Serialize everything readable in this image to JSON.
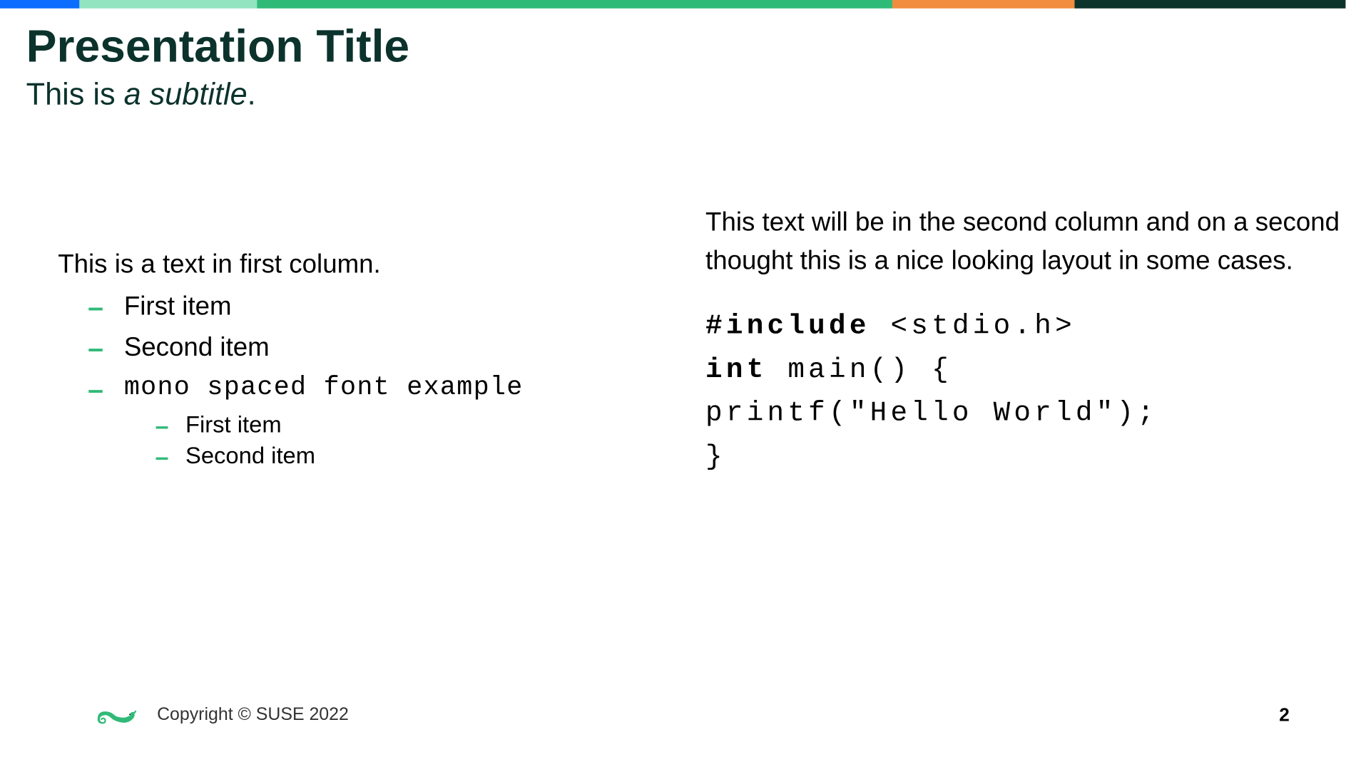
{
  "colors": {
    "bar_blue": "#0d6efd",
    "bar_mint": "#92e3bf",
    "bar_green": "#30ba78",
    "bar_orange": "#f28c3f",
    "bar_dark": "#0c322c",
    "accent_green": "#30ba78",
    "title_color": "#0c322c"
  },
  "title": "Presentation Title",
  "subtitle_prefix": "This is ",
  "subtitle_italic": "a subtitle",
  "subtitle_suffix": ".",
  "left_column": {
    "intro": "This is a text in first column.",
    "items": [
      {
        "text": "First item",
        "mono": false
      },
      {
        "text": "Second item",
        "mono": false
      },
      {
        "text": "mono spaced font example",
        "mono": true
      }
    ],
    "subitems": [
      "First item",
      "Second item"
    ]
  },
  "right_column": {
    "text": "This text will be in the second column and on a second thought this is a nice looking layout in some cases.",
    "code": {
      "line1_kw": "#include",
      "line1_rest": " <stdio.h>",
      "line2_kw": "int",
      "line2_rest": " main() {",
      "line3": "  printf(\"Hello World\");",
      "line4": "}"
    }
  },
  "footer": {
    "copyright": "Copyright © SUSE 2022",
    "page": "2"
  }
}
